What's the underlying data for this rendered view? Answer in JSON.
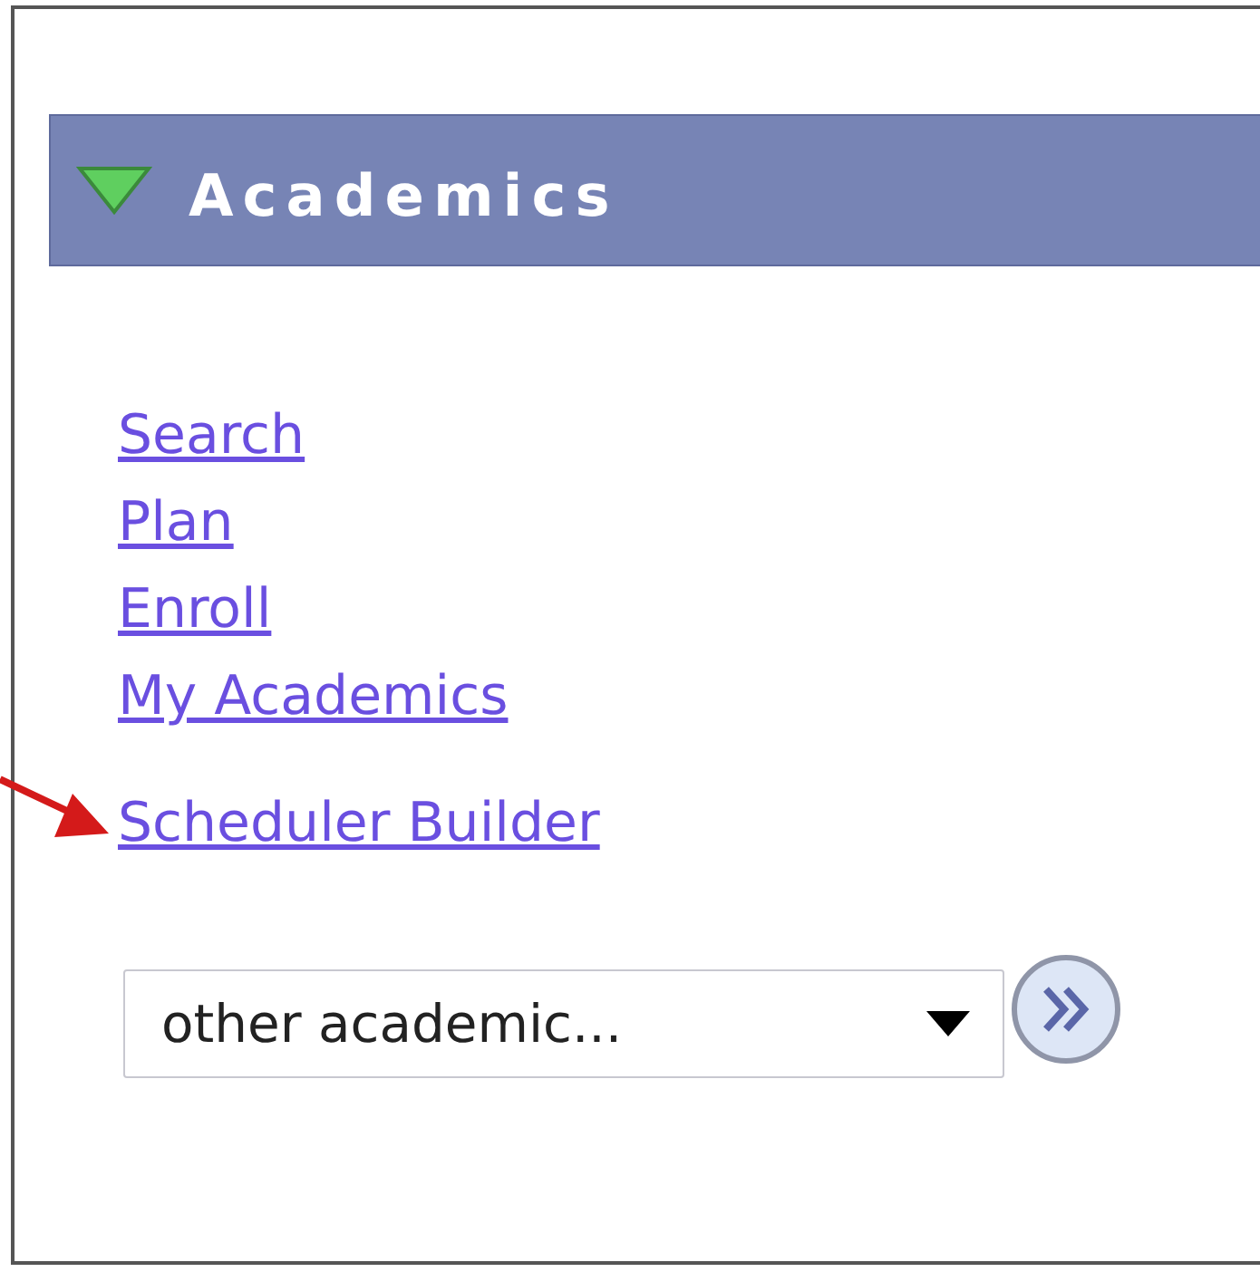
{
  "section": {
    "title": "Academics",
    "expanded": true
  },
  "links": [
    {
      "label": "Search"
    },
    {
      "label": "Plan"
    },
    {
      "label": "Enroll"
    },
    {
      "label": "My Academics"
    }
  ],
  "highlighted_link": {
    "label": "Scheduler Builder"
  },
  "dropdown": {
    "value": "other academic..."
  }
}
